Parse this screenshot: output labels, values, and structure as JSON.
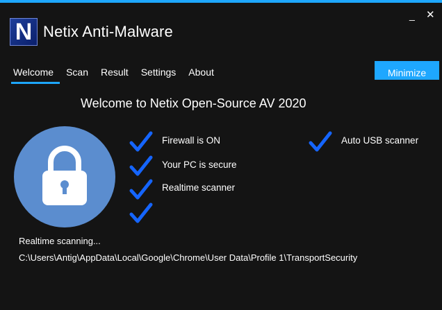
{
  "app": {
    "logo_letter": "N",
    "title": "Netix Anti-Malware"
  },
  "window_controls": {
    "minimize": "_",
    "close": "✕"
  },
  "nav": {
    "items": [
      "Welcome",
      "Scan",
      "Result",
      "Settings",
      "About"
    ],
    "active": "Welcome"
  },
  "minimize_button": "Minimize",
  "welcome_text": "Welcome to Netix Open-Source AV 2020",
  "features": [
    "Firewall is ON",
    "Your PC is secure",
    "Realtime scanner",
    "",
    "Auto USB scanner"
  ],
  "status": {
    "label": "Realtime scanning...",
    "path": "C:\\Users\\Antig\\AppData\\Local\\Google\\Chrome\\User Data\\Profile 1\\TransportSecurity"
  },
  "colors": {
    "accent": "#1ea7ff",
    "check": "#1565ff",
    "shield_circle": "#5b8dcf",
    "background": "#141414"
  },
  "icons": {
    "shield": "lock-icon",
    "check": "checkmark-icon"
  }
}
